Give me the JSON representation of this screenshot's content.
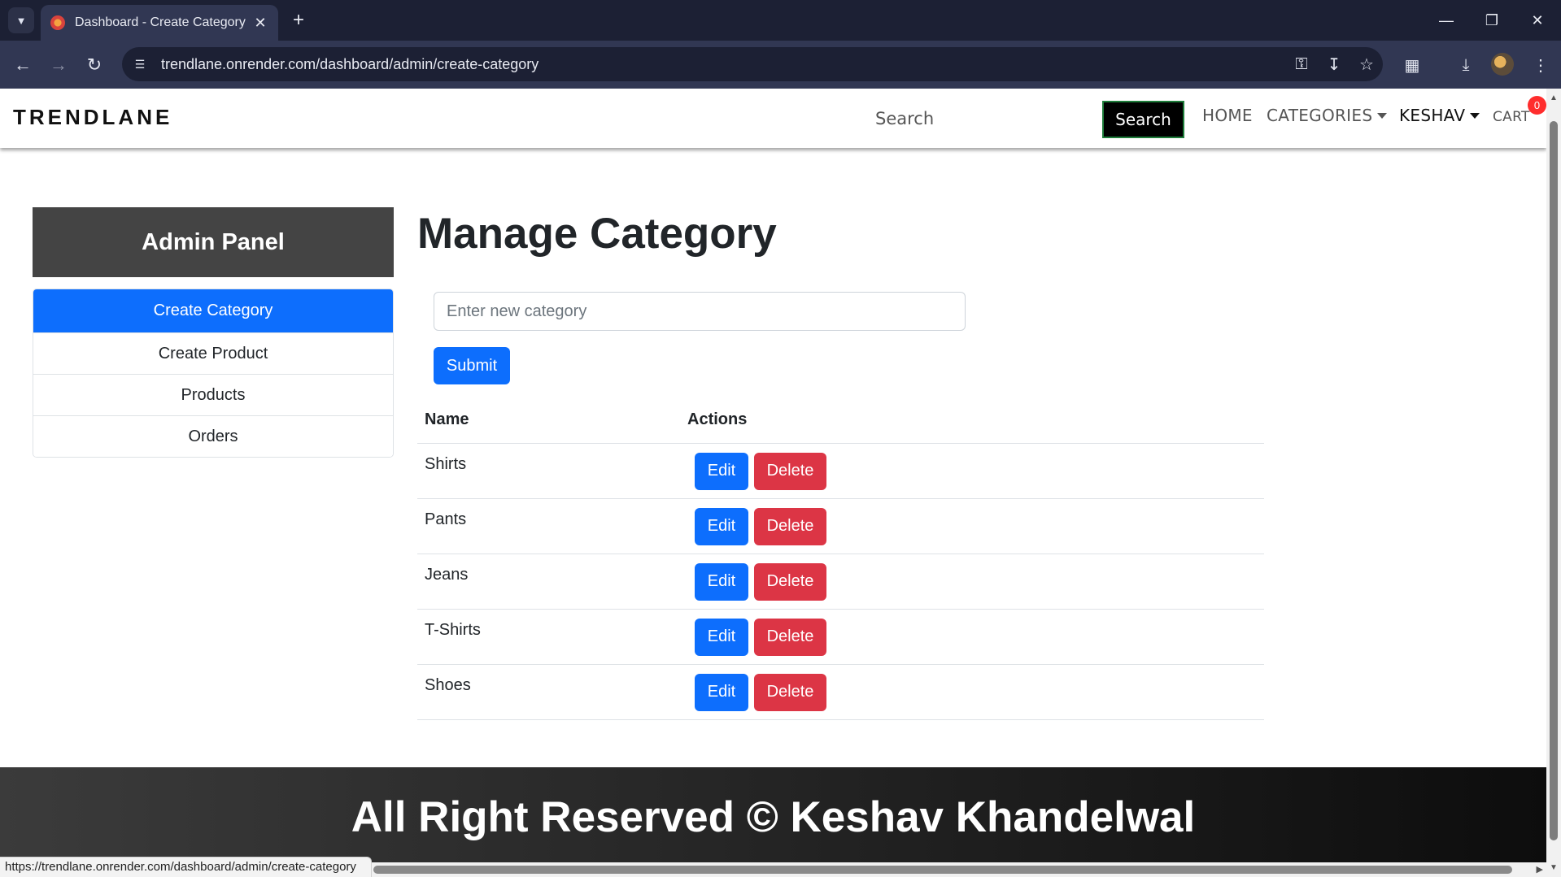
{
  "browser": {
    "tab_title": "Dashboard - Create Category",
    "url": "trendlane.onrender.com/dashboard/admin/create-category",
    "status_url": "https://trendlane.onrender.com/dashboard/admin/create-category"
  },
  "header": {
    "brand": "TRENDLANE",
    "search_placeholder": "Search",
    "search_button": "Search",
    "nav": {
      "home": "HOME",
      "categories": "CATEGORIES",
      "user": "KESHAV",
      "cart": "CART",
      "cart_count": "0"
    }
  },
  "sidebar": {
    "title": "Admin Panel",
    "items": [
      {
        "label": "Create Category",
        "active": true
      },
      {
        "label": "Create Product",
        "active": false
      },
      {
        "label": "Products",
        "active": false
      },
      {
        "label": "Orders",
        "active": false
      }
    ]
  },
  "main": {
    "title": "Manage Category",
    "input_placeholder": "Enter new category",
    "submit_label": "Submit",
    "table": {
      "headers": [
        "Name",
        "Actions"
      ],
      "edit_label": "Edit",
      "delete_label": "Delete",
      "rows": [
        "Shirts",
        "Pants",
        "Jeans",
        "T-Shirts",
        "Shoes"
      ]
    }
  },
  "footer": {
    "text": "All Right Reserved © Keshav Khandelwal"
  },
  "colors": {
    "primary": "#0d6efd",
    "danger": "#dc3545",
    "admin_panel_bg": "#444444",
    "badge": "#ff2d2d"
  }
}
